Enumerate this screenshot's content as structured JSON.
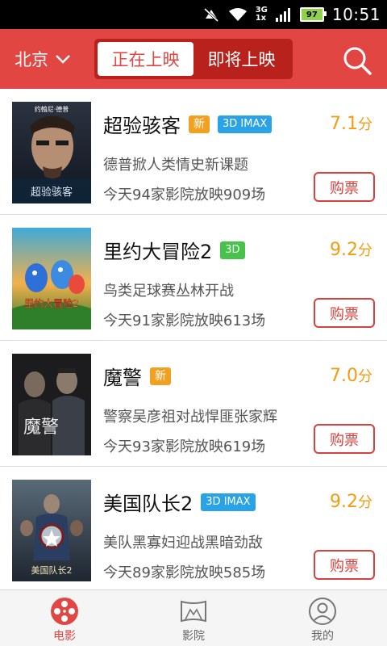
{
  "status_bar": {
    "network_top": "3G",
    "network_bottom": "1x",
    "battery": "97",
    "time": "10:51"
  },
  "header": {
    "city": "北京",
    "tabs": [
      {
        "label": "正在上映",
        "active": true
      },
      {
        "label": "即将上映",
        "active": false
      }
    ]
  },
  "movies": [
    {
      "title": "超验骇客",
      "badges": [
        {
          "text": "新",
          "type": "new"
        },
        {
          "text": "3D IMAX",
          "type": "imax"
        }
      ],
      "score": "7.1",
      "score_unit": "分",
      "desc": "德普掀人类情史新课题",
      "shows": "今天94家影院放映909场",
      "buy_label": "购票",
      "poster": {
        "caption": "超验骇客",
        "top_text": "约翰尼·德普"
      }
    },
    {
      "title": "里约大冒险2",
      "badges": [
        {
          "text": "3D",
          "type": "d3"
        }
      ],
      "score": "9.2",
      "score_unit": "分",
      "desc": "鸟类足球赛丛林开战",
      "shows": "今天91家影院放映613场",
      "buy_label": "购票",
      "poster": {
        "caption": "里约大冒险2",
        "top_text": ""
      }
    },
    {
      "title": "魔警",
      "badges": [
        {
          "text": "新",
          "type": "new"
        }
      ],
      "score": "7.0",
      "score_unit": "分",
      "desc": "警察吴彦祖对战悍匪张家辉",
      "shows": "今天93家影院放映619场",
      "buy_label": "购票",
      "poster": {
        "caption": "魔警",
        "top_text": ""
      }
    },
    {
      "title": "美国队长2",
      "badges": [
        {
          "text": "3D IMAX",
          "type": "imax"
        }
      ],
      "score": "9.2",
      "score_unit": "分",
      "desc": "美队黑寡妇迎战黑暗劲敌",
      "shows": "今天89家影院放映585场",
      "buy_label": "购票",
      "poster": {
        "caption": "美国队长2",
        "top_text": ""
      }
    }
  ],
  "bottom_nav": [
    {
      "label": "电影",
      "icon": "film-reel-icon",
      "active": true
    },
    {
      "label": "影院",
      "icon": "cinema-screen-icon",
      "active": false
    },
    {
      "label": "我的",
      "icon": "profile-icon",
      "active": false
    }
  ],
  "colors": {
    "brand_red": "#e14643",
    "score_orange": "#f39c12",
    "badge_new": "#f2a01f",
    "badge_imax": "#2aa3e6",
    "badge_3d": "#47c24a"
  }
}
